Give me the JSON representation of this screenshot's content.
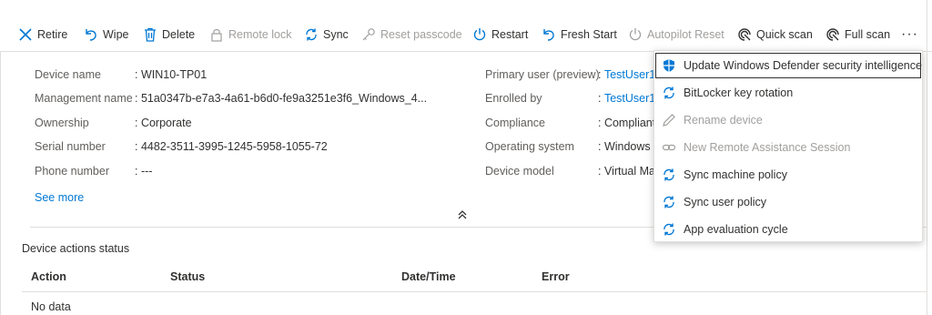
{
  "toolbar": {
    "retire": "Retire",
    "wipe": "Wipe",
    "delete": "Delete",
    "remote_lock": "Remote lock",
    "sync": "Sync",
    "reset_passcode": "Reset passcode",
    "restart": "Restart",
    "fresh_start": "Fresh Start",
    "autopilot_reset": "Autopilot Reset",
    "quick_scan": "Quick scan",
    "full_scan": "Full scan",
    "more": "···"
  },
  "properties_left": [
    {
      "label": "Device name",
      "value": "WIN10-TP01"
    },
    {
      "label": "Management name",
      "value": "51a0347b-e7a3-4a61-b6d0-fe9a3251e3f6_Windows_4..."
    },
    {
      "label": "Ownership",
      "value": "Corporate"
    },
    {
      "label": "Serial number",
      "value": "4482-3511-3995-1245-5958-1055-72"
    },
    {
      "label": "Phone number",
      "value": "---"
    }
  ],
  "properties_right": [
    {
      "label": "Primary user (preview)",
      "value": "TestUser1"
    },
    {
      "label": "Enrolled by",
      "value": "TestUser1"
    },
    {
      "label": "Compliance",
      "value": "Compliant"
    },
    {
      "label": "Operating system",
      "value": "Windows"
    },
    {
      "label": "Device model",
      "value": "Virtual Ma"
    }
  ],
  "see_more": "See more",
  "actions_status": {
    "title": "Device actions status",
    "columns": [
      "Action",
      "Status",
      "Date/Time",
      "Error"
    ],
    "empty_text": "No data"
  },
  "menu": {
    "items": [
      {
        "label": "Update Windows Defender security intelligence",
        "icon": "defender-shield-icon",
        "enabled": true
      },
      {
        "label": "BitLocker key rotation",
        "icon": "sync-icon",
        "enabled": true
      },
      {
        "label": "Rename device",
        "icon": "pencil-icon",
        "enabled": false
      },
      {
        "label": "New Remote Assistance Session",
        "icon": "link-icon",
        "enabled": false
      },
      {
        "label": "Sync machine policy",
        "icon": "sync-icon",
        "enabled": true
      },
      {
        "label": "Sync user policy",
        "icon": "sync-icon",
        "enabled": true
      },
      {
        "label": "App evaluation cycle",
        "icon": "sync-icon",
        "enabled": true
      }
    ]
  },
  "colors": {
    "accent": "#0078d4",
    "text": "#323130",
    "disabled": "#a19f9d",
    "border": "#e1dfdd"
  }
}
